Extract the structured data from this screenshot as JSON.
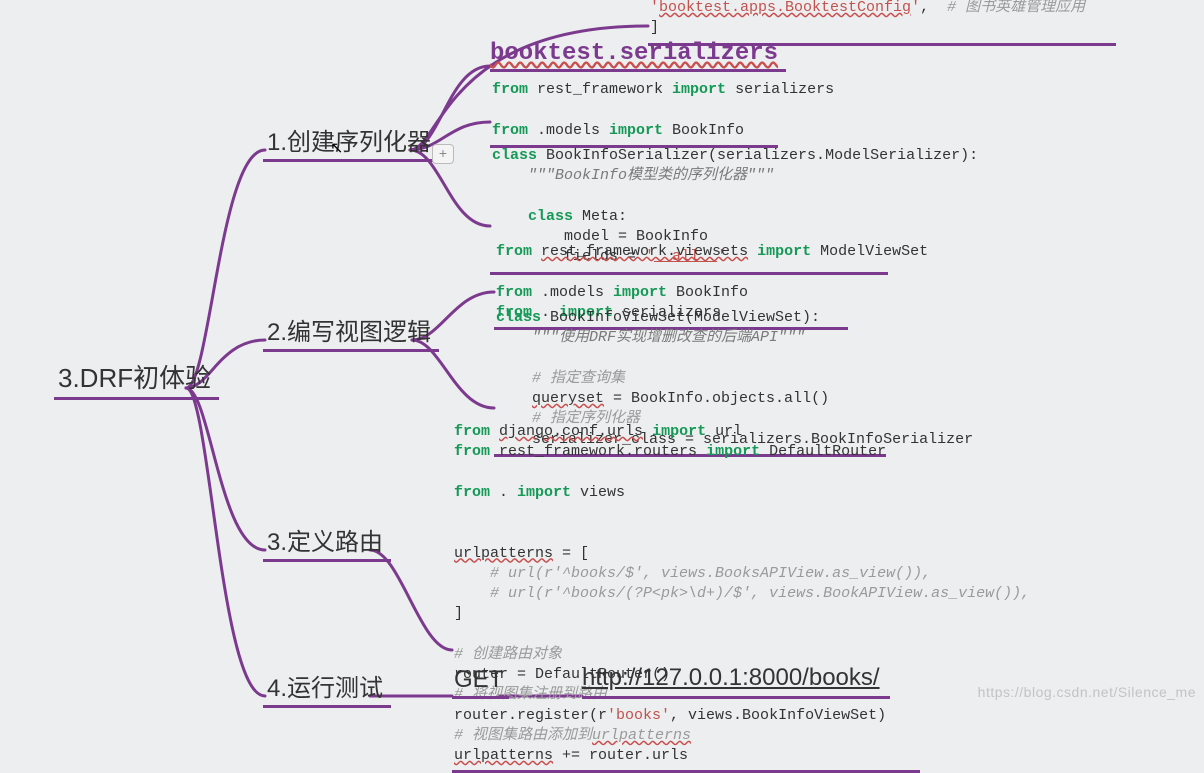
{
  "root": "3.DRF初体验",
  "children": {
    "c1": "1.创建序列化器",
    "c2": "2.编写视图逻辑",
    "c3": "3.定义路由",
    "c4": "4.运行测试"
  },
  "expand_btn": "+",
  "top_code": {
    "text": "'booktest.apps.BooktestConfig',  # 图书英雄管理应用\n]"
  },
  "serializers_title": "booktest.serializers",
  "code_imports1": "from rest_framework import serializers\n\nfrom .models import BookInfo",
  "code_class1": "class BookInfoSerializer(serializers.ModelSerializer):\n    \"\"\"BookInfo模型类的序列化器\"\"\"\n\n    class Meta:\n        model = BookInfo\n        fields = '__all__'",
  "code_views_imports": "from rest_framework.viewsets import ModelViewSet\n\nfrom .models import BookInfo\nfrom . import serializers",
  "code_views_class": "class BookInfoViewSet(ModelViewSet):\n    \"\"\"使用DRF实现增删改查的后端API\"\"\"\n\n    # 指定查询集\n    queryset = BookInfo.objects.all()\n    # 指定序列化器\n    serializer_class = serializers.BookInfoSerializer",
  "code_urls": "from django.conf.urls import url\nfrom rest_framework.routers import DefaultRouter\n\nfrom . import views\n\n\nurlpatterns = [\n    # url(r'^books/$', views.BooksAPIView.as_view()),\n    # url(r'^books/(?P<pk>\\d+)/$', views.BookAPIView.as_view()),\n]\n\n# 创建路由对象\nrouter = DefaultRouter()\n# 将视图集注册到路由\nrouter.register(r'books', views.BookInfoViewSet)\n# 视图集路由添加到urlpatterns\nurlpatterns += router.urls",
  "get_label": "GET",
  "url": "http://127.0.0.1:8000/books/",
  "watermark": "https://blog.csdn.net/Silence_me",
  "colors": {
    "branch": "#7c3a8f"
  }
}
